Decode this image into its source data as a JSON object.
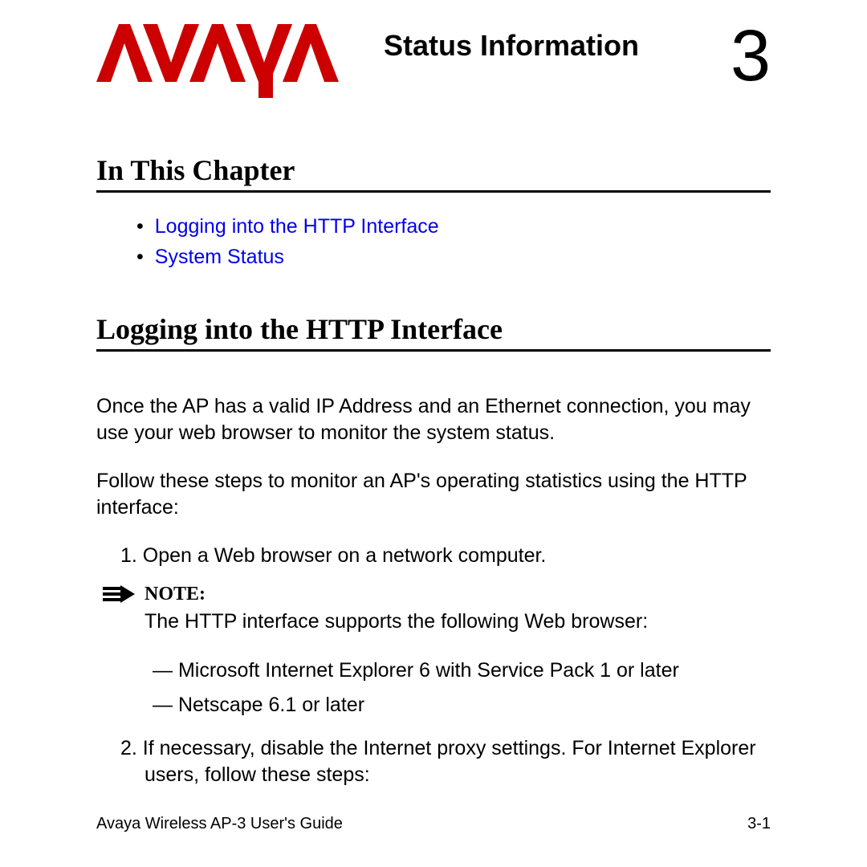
{
  "header": {
    "logo_text": "AVAYA",
    "title": "Status Information",
    "chapter_number": "3"
  },
  "sections": {
    "in_this_chapter": {
      "heading": "In This Chapter"
    },
    "logging_http": {
      "heading": "Logging into the HTTP Interface"
    }
  },
  "toc": {
    "items": [
      "Logging into the HTTP Interface",
      "System Status"
    ]
  },
  "body": {
    "p1": "Once the AP has a valid IP Address and an Ethernet connection, you may use your web browser to monitor the system status.",
    "p2": "Follow these steps to monitor an AP's operating statistics using the HTTP interface:",
    "step1": "1.  Open a Web browser on a network computer.",
    "note_label": "NOTE:",
    "note_text": "The HTTP interface supports the following Web browser:",
    "dash1": "— Microsoft Internet Explorer 6 with Service Pack 1 or later",
    "dash2": "— Netscape 6.1 or later",
    "step2": "2.  If necessary, disable the Internet proxy settings. For Internet Explorer users, follow these steps:"
  },
  "footer": {
    "left": "Avaya Wireless AP-3 User's Guide",
    "right": "3-1"
  }
}
